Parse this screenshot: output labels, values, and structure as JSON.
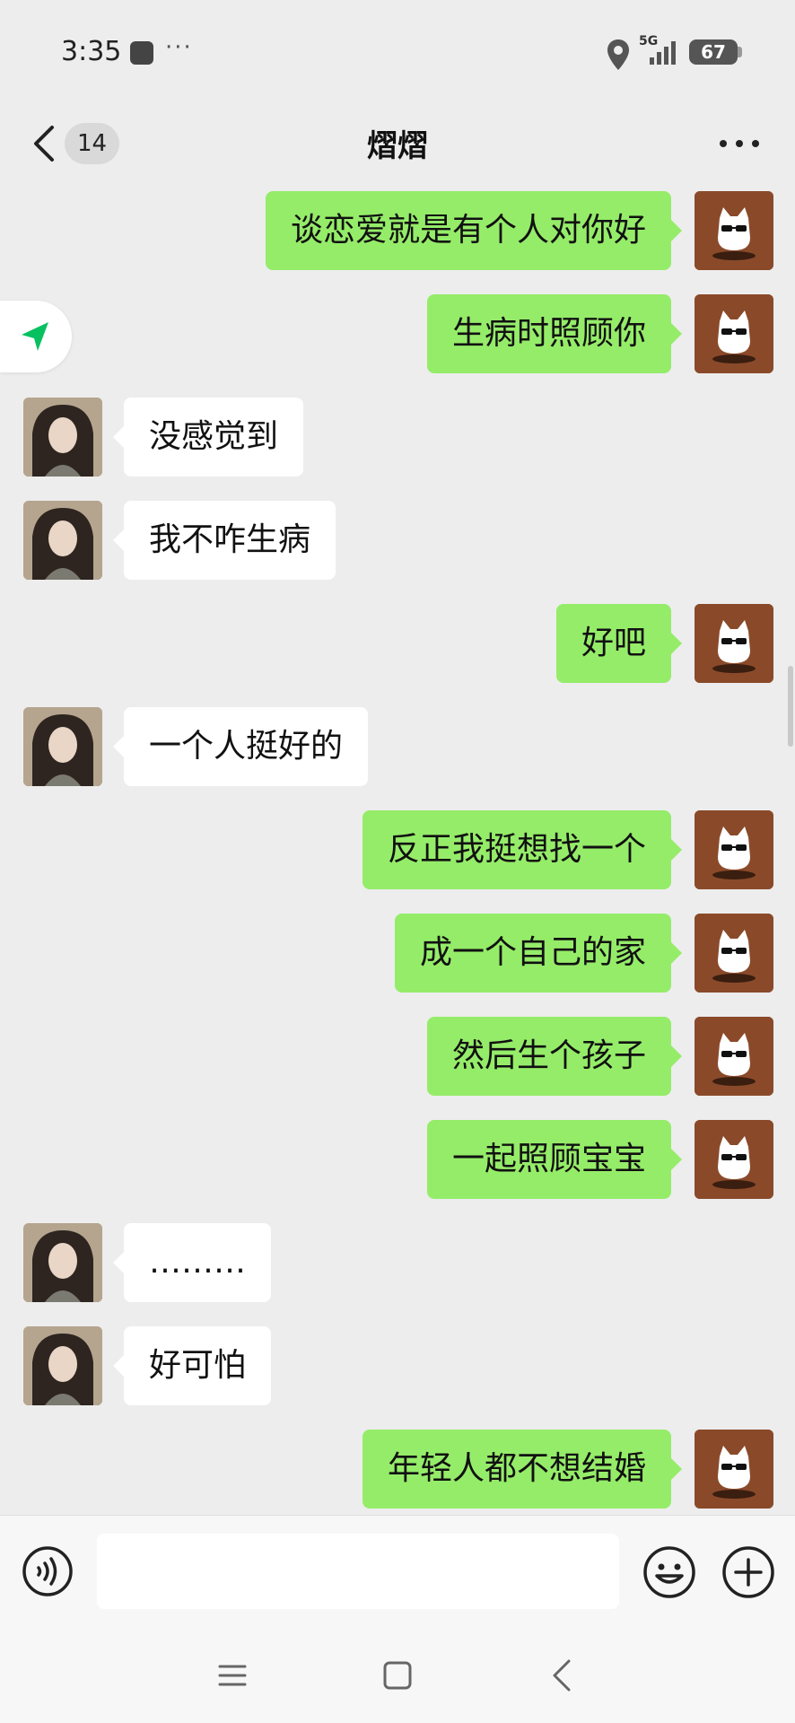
{
  "status_bar": {
    "time": "3:35",
    "dots": "···",
    "network": "5G",
    "battery": "67"
  },
  "header": {
    "unread_count": "14",
    "title": "熠熠"
  },
  "messages": [
    {
      "from": "me",
      "text": "谈恋爱就是有个人对你好"
    },
    {
      "from": "me",
      "text": "生病时照顾你"
    },
    {
      "from": "her",
      "text": "没感觉到"
    },
    {
      "from": "her",
      "text": "我不咋生病"
    },
    {
      "from": "me",
      "text": "好吧"
    },
    {
      "from": "her",
      "text": "一个人挺好的"
    },
    {
      "from": "me",
      "text": "反正我挺想找一个"
    },
    {
      "from": "me",
      "text": "成一个自己的家"
    },
    {
      "from": "me",
      "text": "然后生个孩子"
    },
    {
      "from": "me",
      "text": "一起照顾宝宝"
    },
    {
      "from": "her",
      "text": "………"
    },
    {
      "from": "her",
      "text": "好可怕"
    },
    {
      "from": "me",
      "text": "年轻人都不想结婚"
    }
  ],
  "colors": {
    "background": "#ededed",
    "my_bubble": "#95ec69",
    "her_bubble": "#ffffff",
    "location_accent": "#07c160"
  },
  "icons": {
    "back": "chevron-left-icon",
    "more": "more-dots-icon",
    "voice": "voice-icon",
    "emoji": "emoji-icon",
    "plus": "plus-icon",
    "location": "location-arrow-icon"
  }
}
